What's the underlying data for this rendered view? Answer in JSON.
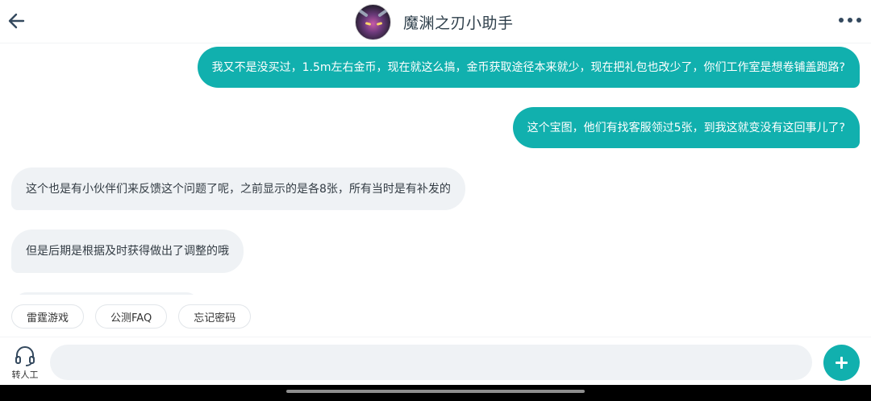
{
  "header": {
    "title": "魔渊之刃小助手",
    "back_icon": "arrow-left-icon",
    "more_icon": "more-horizontal-icon",
    "avatar": "bot-avatar"
  },
  "messages": [
    {
      "side": "out",
      "text": "我又不是没买过，1.5m左右金币，现在就这么搞，金币获取途径本来就少，现在把礼包也改少了，你们工作室是想卷铺盖跑路?"
    },
    {
      "side": "out",
      "text": "这个宝图，他们有找客服领过5张，到我这就变没有这回事儿了?"
    },
    {
      "side": "in",
      "text": "这个也是有小伙伴们来反馈这个问题了呢，之前显示的是各8张，所有当时是有补发的"
    },
    {
      "side": "in",
      "text": "但是后期是根据及时获得做出了调整的哦"
    }
  ],
  "quick_replies": [
    "雷霆游戏",
    "公测FAQ",
    "忘记密码"
  ],
  "bottom": {
    "agent_label": "转人工",
    "agent_icon": "headset-icon",
    "input_value": "",
    "plus_icon": "plus-icon"
  },
  "colors": {
    "accent": "#11b0ae",
    "incoming_bubble": "#eff2f5",
    "title_text": "#2d3e4a"
  }
}
